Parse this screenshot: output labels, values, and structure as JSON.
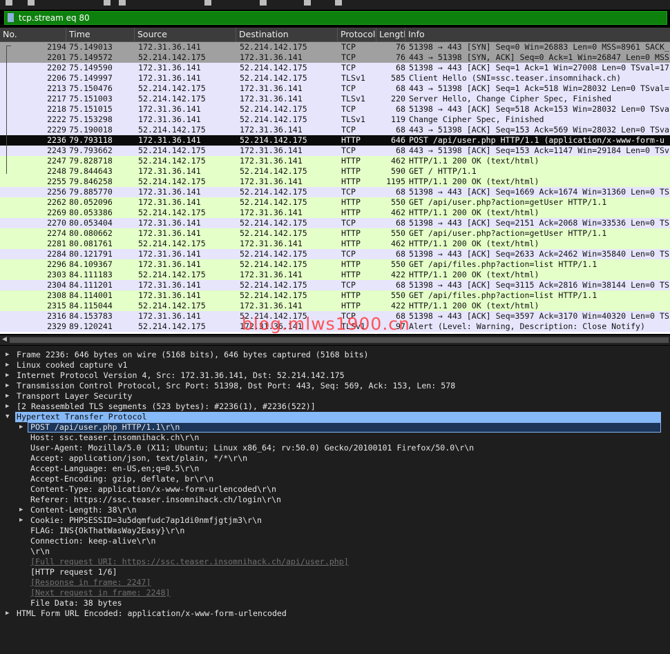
{
  "filter": {
    "value": "tcp.stream eq 80"
  },
  "columns": [
    "No.",
    "Time",
    "Source",
    "Destination",
    "Protocol",
    "Length",
    "Info"
  ],
  "packets": [
    {
      "no": "2194",
      "time": "75.149013",
      "src": "172.31.36.141",
      "dst": "52.214.142.175",
      "proto": "TCP",
      "len": "76",
      "info": "51398 → 443 [SYN] Seq=0 Win=26883 Len=0 MSS=8961 SACK_",
      "kind": "syn"
    },
    {
      "no": "2201",
      "time": "75.149572",
      "src": "52.214.142.175",
      "dst": "172.31.36.141",
      "proto": "TCP",
      "len": "76",
      "info": "443 → 51398 [SYN, ACK] Seq=0 Ack=1 Win=26847 Len=0 MSS",
      "kind": "syn"
    },
    {
      "no": "2202",
      "time": "75.149590",
      "src": "172.31.36.141",
      "dst": "52.214.142.175",
      "proto": "TCP",
      "len": "68",
      "info": "51398 → 443 [ACK] Seq=1 Ack=1 Win=27008 Len=0 TSval=17",
      "kind": "tcp"
    },
    {
      "no": "2206",
      "time": "75.149997",
      "src": "172.31.36.141",
      "dst": "52.214.142.175",
      "proto": "TLSv1",
      "len": "585",
      "info": "Client Hello (SNI=ssc.teaser.insomnihack.ch)",
      "kind": "tls"
    },
    {
      "no": "2213",
      "time": "75.150476",
      "src": "52.214.142.175",
      "dst": "172.31.36.141",
      "proto": "TCP",
      "len": "68",
      "info": "443 → 51398 [ACK] Seq=1 Ack=518 Win=28032 Len=0 TSval=",
      "kind": "tcp"
    },
    {
      "no": "2217",
      "time": "75.151003",
      "src": "52.214.142.175",
      "dst": "172.31.36.141",
      "proto": "TLSv1",
      "len": "220",
      "info": "Server Hello, Change Cipher Spec, Finished",
      "kind": "tls"
    },
    {
      "no": "2218",
      "time": "75.151015",
      "src": "172.31.36.141",
      "dst": "52.214.142.175",
      "proto": "TCP",
      "len": "68",
      "info": "51398 → 443 [ACK] Seq=518 Ack=153 Win=28032 Len=0 TSva",
      "kind": "tcp"
    },
    {
      "no": "2222",
      "time": "75.153298",
      "src": "172.31.36.141",
      "dst": "52.214.142.175",
      "proto": "TLSv1",
      "len": "119",
      "info": "Change Cipher Spec, Finished",
      "kind": "tls"
    },
    {
      "no": "2229",
      "time": "75.190018",
      "src": "52.214.142.175",
      "dst": "172.31.36.141",
      "proto": "TCP",
      "len": "68",
      "info": "443 → 51398 [ACK] Seq=153 Ack=569 Win=28032 Len=0 TSva",
      "kind": "tcp"
    },
    {
      "no": "2236",
      "time": "79.793118",
      "src": "172.31.36.141",
      "dst": "52.214.142.175",
      "proto": "HTTP",
      "len": "646",
      "info": "POST /api/user.php HTTP/1.1  (application/x-www-form-u",
      "kind": "sel"
    },
    {
      "no": "2243",
      "time": "79.793662",
      "src": "52.214.142.175",
      "dst": "172.31.36.141",
      "proto": "TCP",
      "len": "68",
      "info": "443 → 51398 [ACK] Seq=153 Ack=1147 Win=29184 Len=0 TSv",
      "kind": "tcp"
    },
    {
      "no": "2247",
      "time": "79.828718",
      "src": "52.214.142.175",
      "dst": "172.31.36.141",
      "proto": "HTTP",
      "len": "462",
      "info": "HTTP/1.1 200 OK  (text/html)",
      "kind": "http"
    },
    {
      "no": "2248",
      "time": "79.844643",
      "src": "172.31.36.141",
      "dst": "52.214.142.175",
      "proto": "HTTP",
      "len": "590",
      "info": "GET / HTTP/1.1",
      "kind": "http"
    },
    {
      "no": "2255",
      "time": "79.846258",
      "src": "52.214.142.175",
      "dst": "172.31.36.141",
      "proto": "HTTP",
      "len": "1195",
      "info": "HTTP/1.1 200 OK  (text/html)",
      "kind": "http"
    },
    {
      "no": "2256",
      "time": "79.885770",
      "src": "172.31.36.141",
      "dst": "52.214.142.175",
      "proto": "TCP",
      "len": "68",
      "info": "51398 → 443 [ACK] Seq=1669 Ack=1674 Win=31360 Len=0 TS",
      "kind": "tcp"
    },
    {
      "no": "2262",
      "time": "80.052096",
      "src": "172.31.36.141",
      "dst": "52.214.142.175",
      "proto": "HTTP",
      "len": "550",
      "info": "GET /api/user.php?action=getUser HTTP/1.1",
      "kind": "http"
    },
    {
      "no": "2269",
      "time": "80.053386",
      "src": "52.214.142.175",
      "dst": "172.31.36.141",
      "proto": "HTTP",
      "len": "462",
      "info": "HTTP/1.1 200 OK  (text/html)",
      "kind": "http"
    },
    {
      "no": "2270",
      "time": "80.053404",
      "src": "172.31.36.141",
      "dst": "52.214.142.175",
      "proto": "TCP",
      "len": "68",
      "info": "51398 → 443 [ACK] Seq=2151 Ack=2068 Win=33536 Len=0 TS",
      "kind": "tcp"
    },
    {
      "no": "2274",
      "time": "80.080662",
      "src": "172.31.36.141",
      "dst": "52.214.142.175",
      "proto": "HTTP",
      "len": "550",
      "info": "GET /api/user.php?action=getUser HTTP/1.1",
      "kind": "http"
    },
    {
      "no": "2281",
      "time": "80.081761",
      "src": "52.214.142.175",
      "dst": "172.31.36.141",
      "proto": "HTTP",
      "len": "462",
      "info": "HTTP/1.1 200 OK  (text/html)",
      "kind": "http"
    },
    {
      "no": "2284",
      "time": "80.121791",
      "src": "172.31.36.141",
      "dst": "52.214.142.175",
      "proto": "TCP",
      "len": "68",
      "info": "51398 → 443 [ACK] Seq=2633 Ack=2462 Win=35840 Len=0 TS",
      "kind": "tcp"
    },
    {
      "no": "2296",
      "time": "84.109367",
      "src": "172.31.36.141",
      "dst": "52.214.142.175",
      "proto": "HTTP",
      "len": "550",
      "info": "GET /api/files.php?action=list HTTP/1.1",
      "kind": "http"
    },
    {
      "no": "2303",
      "time": "84.111183",
      "src": "52.214.142.175",
      "dst": "172.31.36.141",
      "proto": "HTTP",
      "len": "422",
      "info": "HTTP/1.1 200 OK  (text/html)",
      "kind": "http"
    },
    {
      "no": "2304",
      "time": "84.111201",
      "src": "172.31.36.141",
      "dst": "52.214.142.175",
      "proto": "TCP",
      "len": "68",
      "info": "51398 → 443 [ACK] Seq=3115 Ack=2816 Win=38144 Len=0 TS",
      "kind": "tcp"
    },
    {
      "no": "2308",
      "time": "84.114001",
      "src": "172.31.36.141",
      "dst": "52.214.142.175",
      "proto": "HTTP",
      "len": "550",
      "info": "GET /api/files.php?action=list HTTP/1.1",
      "kind": "http"
    },
    {
      "no": "2315",
      "time": "84.115044",
      "src": "52.214.142.175",
      "dst": "172.31.36.141",
      "proto": "HTTP",
      "len": "422",
      "info": "HTTP/1.1 200 OK  (text/html)",
      "kind": "http"
    },
    {
      "no": "2316",
      "time": "84.153783",
      "src": "172.31.36.141",
      "dst": "52.214.142.175",
      "proto": "TCP",
      "len": "68",
      "info": "51398 → 443 [ACK] Seq=3597 Ack=3170 Win=40320 Len=0 TS",
      "kind": "tcp"
    },
    {
      "no": "2329",
      "time": "89.120241",
      "src": "52.214.142.175",
      "dst": "172.31.36.141",
      "proto": "TLSv1",
      "len": "97",
      "info": "Alert (Level: Warning, Description: Close Notify)",
      "kind": "tls"
    }
  ],
  "watermark": "blog.mlws1900.cn",
  "details": [
    {
      "text": "Frame 2236: 646 bytes on wire (5168 bits), 646 bytes captured (5168 bits)",
      "level": 0,
      "arrow": "right",
      "style": ""
    },
    {
      "text": "Linux cooked capture v1",
      "level": 0,
      "arrow": "right",
      "style": ""
    },
    {
      "text": "Internet Protocol Version 4, Src: 172.31.36.141, Dst: 52.214.142.175",
      "level": 0,
      "arrow": "right",
      "style": ""
    },
    {
      "text": "Transmission Control Protocol, Src Port: 51398, Dst Port: 443, Seq: 569, Ack: 153, Len: 578",
      "level": 0,
      "arrow": "right",
      "style": ""
    },
    {
      "text": "Transport Layer Security",
      "level": 0,
      "arrow": "right",
      "style": ""
    },
    {
      "text": "[2 Reassembled TLS segments (523 bytes): #2236(1), #2236(522)]",
      "level": 0,
      "arrow": "right",
      "style": ""
    },
    {
      "text": "Hypertext Transfer Protocol",
      "level": 0,
      "arrow": "down",
      "style": "hl"
    },
    {
      "text": "POST /api/user.php HTTP/1.1\\r\\n",
      "level": 1,
      "arrow": "right",
      "style": "hl2"
    },
    {
      "text": "Host: ssc.teaser.insomnihack.ch\\r\\n",
      "level": 1,
      "arrow": "",
      "style": ""
    },
    {
      "text": "User-Agent: Mozilla/5.0 (X11; Ubuntu; Linux x86_64; rv:50.0) Gecko/20100101 Firefox/50.0\\r\\n",
      "level": 1,
      "arrow": "",
      "style": ""
    },
    {
      "text": "Accept: application/json, text/plain, */*\\r\\n",
      "level": 1,
      "arrow": "",
      "style": ""
    },
    {
      "text": "Accept-Language: en-US,en;q=0.5\\r\\n",
      "level": 1,
      "arrow": "",
      "style": ""
    },
    {
      "text": "Accept-Encoding: gzip, deflate, br\\r\\n",
      "level": 1,
      "arrow": "",
      "style": ""
    },
    {
      "text": "Content-Type: application/x-www-form-urlencoded\\r\\n",
      "level": 1,
      "arrow": "",
      "style": ""
    },
    {
      "text": "Referer: https://ssc.teaser.insomnihack.ch/login\\r\\n",
      "level": 1,
      "arrow": "",
      "style": ""
    },
    {
      "text": "Content-Length: 38\\r\\n",
      "level": 1,
      "arrow": "right",
      "style": ""
    },
    {
      "text": "Cookie: PHPSESSID=3u5dqmfudc7ap1di0nmfjgtjm3\\r\\n",
      "level": 1,
      "arrow": "right",
      "style": ""
    },
    {
      "text": "FLAG: INS{OkThatWasWay2Easy}\\r\\n",
      "level": 1,
      "arrow": "",
      "style": ""
    },
    {
      "text": "Connection: keep-alive\\r\\n",
      "level": 1,
      "arrow": "",
      "style": ""
    },
    {
      "text": "\\r\\n",
      "level": 1,
      "arrow": "",
      "style": ""
    },
    {
      "text": "[Full request URI: https://ssc.teaser.insomnihack.ch/api/user.php]",
      "level": 1,
      "arrow": "",
      "style": "dim"
    },
    {
      "text": "[HTTP request 1/6]",
      "level": 1,
      "arrow": "",
      "style": ""
    },
    {
      "text": "[Response in frame: 2247]",
      "level": 1,
      "arrow": "",
      "style": "dim"
    },
    {
      "text": "[Next request in frame: 2248]",
      "level": 1,
      "arrow": "",
      "style": "dim"
    },
    {
      "text": "File Data: 38 bytes",
      "level": 1,
      "arrow": "",
      "style": ""
    },
    {
      "text": "HTML Form URL Encoded: application/x-www-form-urlencoded",
      "level": 0,
      "arrow": "right",
      "style": ""
    }
  ]
}
